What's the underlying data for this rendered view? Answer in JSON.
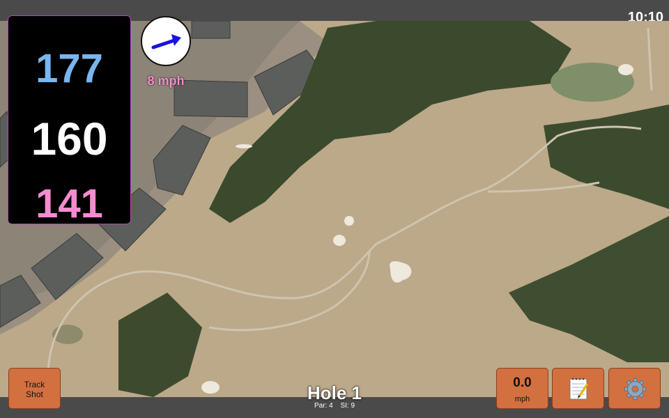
{
  "status_bar": {
    "time": "10:10"
  },
  "yardage": {
    "back": "177",
    "middle": "160",
    "front": "141"
  },
  "wind": {
    "speed_label": "8 mph",
    "direction": "arrow-right-up-icon"
  },
  "buttons": {
    "track_shot": {
      "line1": "Track",
      "line2": "Shot"
    },
    "speed": {
      "value": "0.0",
      "unit": "mph"
    },
    "notes": {
      "icon": "notepad-icon"
    },
    "settings": {
      "icon": "gear-icon"
    }
  },
  "hole": {
    "title": "Hole 1",
    "par": "Par: 4",
    "si": "SI: 9"
  },
  "colors": {
    "back": "#79b5ee",
    "middle": "#ffffff",
    "front": "#f48ccf",
    "button": "#d2703f",
    "bar": "#4a4a4a"
  }
}
